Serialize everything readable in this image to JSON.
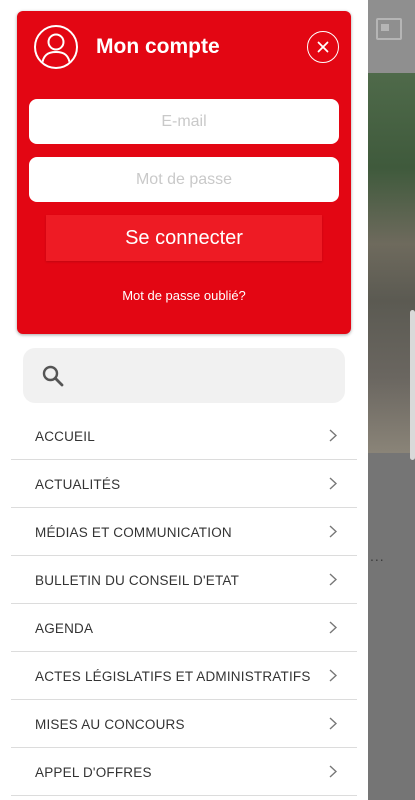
{
  "account": {
    "title": "Mon compte",
    "email_placeholder": "E-mail",
    "password_placeholder": "Mot de passe",
    "login_label": "Se connecter",
    "forgot_label": "Mot de passe oublié?",
    "accent_color": "#e30613"
  },
  "search": {
    "icon": "search-icon"
  },
  "menu": {
    "items": [
      {
        "label": "ACCUEIL"
      },
      {
        "label": "ACTUALITÉS"
      },
      {
        "label": "MÉDIAS ET COMMUNICATION"
      },
      {
        "label": "BULLETIN DU CONSEIL D'ETAT"
      },
      {
        "label": "AGENDA"
      },
      {
        "label": "ACTES LÉGISLATIFS ET ADMINISTRATIFS"
      },
      {
        "label": "MISES AU CONCOURS"
      },
      {
        "label": "APPEL D'OFFRES"
      }
    ]
  },
  "background": {
    "ellipsis": "..."
  }
}
